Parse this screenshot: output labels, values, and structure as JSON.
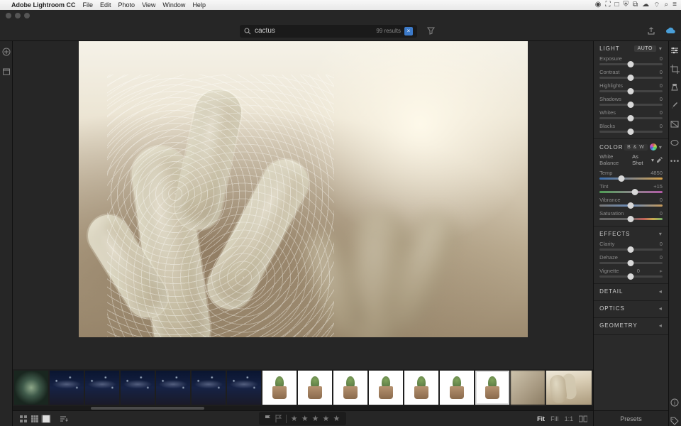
{
  "mac_menu": {
    "app": "Adobe Lightroom CC",
    "items": [
      "File",
      "Edit",
      "Photo",
      "View",
      "Window",
      "Help"
    ]
  },
  "toolbar": {
    "search_query": "cactus",
    "result_count": "99 results"
  },
  "panels": {
    "light": {
      "title": "Light",
      "auto": "Auto",
      "sliders": {
        "exposure": {
          "label": "Exposure",
          "value": "0",
          "pos": 50
        },
        "contrast": {
          "label": "Contrast",
          "value": "0",
          "pos": 50
        },
        "highlights": {
          "label": "Highlights",
          "value": "0",
          "pos": 50
        },
        "shadows": {
          "label": "Shadows",
          "value": "0",
          "pos": 50
        },
        "whites": {
          "label": "Whites",
          "value": "0",
          "pos": 50
        },
        "blacks": {
          "label": "Blacks",
          "value": "0",
          "pos": 50
        }
      }
    },
    "color": {
      "title": "Color",
      "bw": "B & W",
      "wb_label": "White Balance",
      "wb_value": "As Shot",
      "sliders": {
        "temp": {
          "label": "Temp",
          "value": "4850",
          "pos": 35
        },
        "tint": {
          "label": "Tint",
          "value": "+15",
          "pos": 56
        },
        "vibrance": {
          "label": "Vibrance",
          "value": "0",
          "pos": 50
        },
        "saturation": {
          "label": "Saturation",
          "value": "0",
          "pos": 50
        }
      }
    },
    "effects": {
      "title": "Effects",
      "sliders": {
        "clarity": {
          "label": "Clarity",
          "value": "0",
          "pos": 50
        },
        "dehaze": {
          "label": "Dehaze",
          "value": "0",
          "pos": 50
        },
        "vignette": {
          "label": "Vignette",
          "value": "0",
          "pos": 50
        }
      }
    },
    "detail": {
      "title": "Detail"
    },
    "optics": {
      "title": "Optics"
    },
    "geometry": {
      "title": "Geometry"
    }
  },
  "bottom": {
    "fit": "Fit",
    "fill": "Fill",
    "one_to_one": "1:1",
    "presets": "Presets"
  },
  "icons": {
    "search": "search-icon",
    "clear": "×",
    "filter": "funnel-icon",
    "share": "share-icon",
    "cloud": "cloud-sync-icon",
    "add": "plus-icon",
    "library": "grid-icon"
  }
}
